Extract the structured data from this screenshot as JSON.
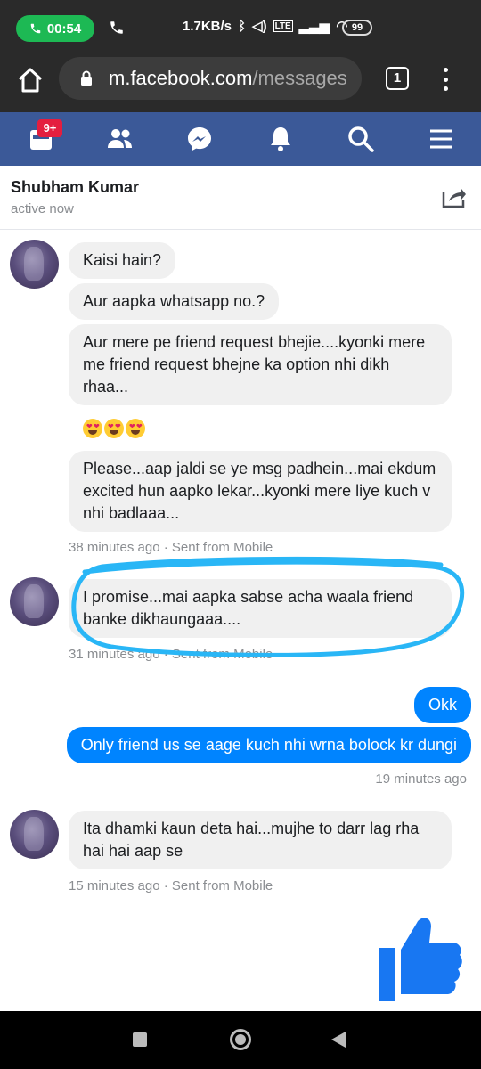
{
  "status_bar": {
    "call_time": "00:54",
    "network_speed": "1.7KB/s",
    "battery": "99",
    "icons": [
      "phone-icon",
      "bluetooth-icon",
      "vibrate-icon",
      "volte-icon",
      "signal-icon",
      "wifi-icon",
      "battery-icon"
    ]
  },
  "browser": {
    "url_host": "m.facebook.com",
    "url_path": "/messages",
    "tab_count": "1"
  },
  "fb_nav": {
    "home_badge": "9+",
    "items": [
      "home-icon",
      "friends-icon",
      "messenger-icon",
      "notifications-icon",
      "search-icon",
      "menu-icon"
    ],
    "accent": "#3b5998"
  },
  "conversation": {
    "name": "Shubham Kumar",
    "status": "active now"
  },
  "messages": {
    "m1": "Kaisi hain?",
    "m2": "Aur aapka whatsapp no.?",
    "m3": "Aur mere pe friend request bhejie....kyonki mere me friend request bhejne ka option nhi dikh rhaa...",
    "m4": "Please...aap jaldi se ye msg padhein...mai ekdum excited hun aapko lekar...kyonki mere liye kuch v nhi badlaaa...",
    "m4_meta": "38 minutes ago · Sent from Mobile",
    "m5": "I promise...mai aapka sabse acha waala friend banke dikhaungaaa....",
    "m5_meta": "31 minutes ago · Sent from Mobile",
    "out1": "Okk",
    "out2": "Only friend us se aage kuch nhi wrna bolock kr dungi",
    "out_meta": "19 minutes ago",
    "m6": "Ita dhamki kaun deta hai...mujhe to darr lag rha hai hai aap se",
    "m6_meta": "15 minutes ago · Sent from Mobile"
  },
  "colors": {
    "outgoing_bubble": "#0084ff",
    "incoming_bubble": "#f0f0f0",
    "highlight_scribble": "#29b6f6",
    "like": "#1877f2"
  }
}
